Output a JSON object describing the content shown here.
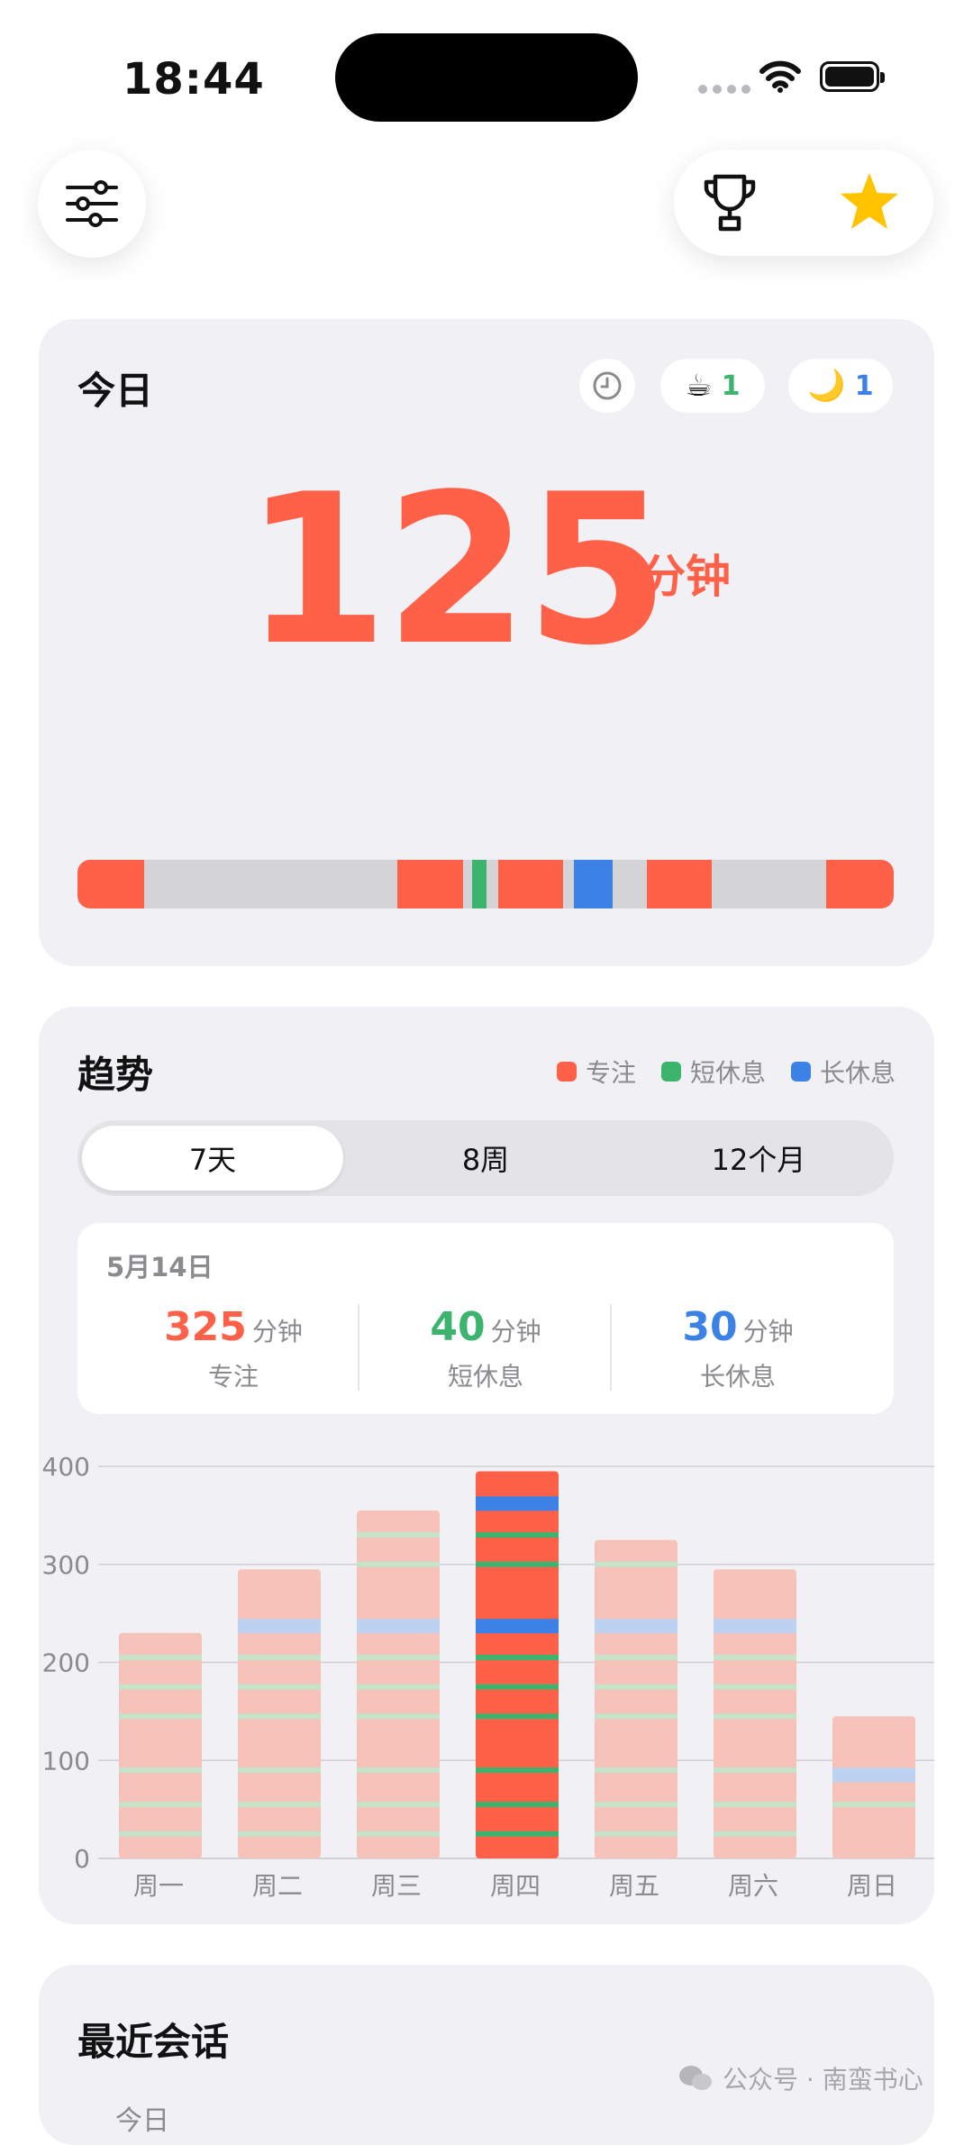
{
  "status": {
    "time": "18:44"
  },
  "colors": {
    "focus": "#ff6148",
    "short_break": "#3cb46e",
    "long_break": "#3c82e6",
    "idle": "#d3d3d8"
  },
  "top_bar": {
    "left_icon": "sliders-icon",
    "right_icons": [
      "trophy-icon",
      "star-icon"
    ]
  },
  "today": {
    "title": "今日",
    "badges": {
      "history_icon": "clock-icon",
      "coffee_emoji": "☕",
      "coffee_count": "1",
      "moon_emoji": "🌙",
      "moon_count": "1"
    },
    "total_value": "125",
    "total_unit": "分钟",
    "timeline": [
      {
        "type": "focus",
        "start": 0.0,
        "end": 0.082
      },
      {
        "type": "focus",
        "start": 0.392,
        "end": 0.472
      },
      {
        "type": "short_break",
        "start": 0.483,
        "end": 0.501
      },
      {
        "type": "focus",
        "start": 0.516,
        "end": 0.595
      },
      {
        "type": "long_break",
        "start": 0.608,
        "end": 0.656
      },
      {
        "type": "focus",
        "start": 0.698,
        "end": 0.777
      },
      {
        "type": "focus",
        "start": 0.917,
        "end": 1.0
      }
    ]
  },
  "trend": {
    "title": "趋势",
    "legend": [
      {
        "label": "专注",
        "color": "#ff6148"
      },
      {
        "label": "短休息",
        "color": "#3cb46e"
      },
      {
        "label": "长休息",
        "color": "#3c82e6"
      }
    ],
    "tabs": [
      {
        "label": "7天",
        "active": true
      },
      {
        "label": "8周",
        "active": false
      },
      {
        "label": "12个月",
        "active": false
      }
    ],
    "detail": {
      "date": "5月14日",
      "focus_value": "325",
      "focus_unit": "分钟",
      "focus_label": "专注",
      "short_value": "40",
      "short_unit": "分钟",
      "short_label": "短休息",
      "long_value": "30",
      "long_unit": "分钟",
      "long_label": "长休息"
    }
  },
  "chart_data": {
    "type": "bar",
    "categories": [
      "周一",
      "周二",
      "周三",
      "周四",
      "周五",
      "周六",
      "周日"
    ],
    "values": [
      230,
      295,
      355,
      395,
      325,
      295,
      145
    ],
    "selected_index": 3,
    "short_break_marks": [
      [
        25,
        55,
        90,
        145,
        175,
        205
      ],
      [
        25,
        55,
        90,
        145,
        175,
        205
      ],
      [
        25,
        55,
        90,
        145,
        175,
        205,
        300,
        330
      ],
      [
        25,
        55,
        90,
        145,
        175,
        205,
        300,
        330
      ],
      [
        25,
        55,
        90,
        145,
        175,
        205,
        300
      ],
      [
        25,
        55,
        90,
        145,
        175,
        205
      ],
      [
        55
      ]
    ],
    "long_break_marks": [
      [],
      [
        237
      ],
      [
        237
      ],
      [
        237,
        362
      ],
      [
        237
      ],
      [
        237
      ],
      [
        85
      ]
    ],
    "ylim": [
      0,
      400
    ],
    "yticks": [
      0,
      100,
      200,
      300,
      400
    ],
    "grid": true
  },
  "recent": {
    "title": "最近会话",
    "first_item": "今日"
  },
  "watermark": {
    "icon": "wechat-icon",
    "text": "公众号 · 南蛮书心"
  }
}
